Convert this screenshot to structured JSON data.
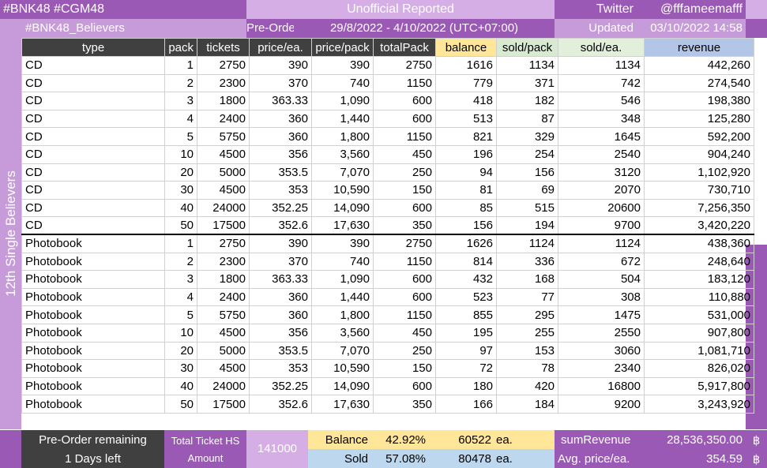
{
  "header": {
    "tags": "#BNK48 #CGM48",
    "title": "Unofficial  Reported",
    "platform": "Twitter",
    "handle": "@fffameemafff",
    "hashtag": "#BNK48_Believers",
    "preorder_label": "Pre-Order",
    "preorder_range": "29/8/2022 - 4/10/2022 (UTC+07:00)",
    "updated_label": "Updated",
    "updated_value": "03/10/2022 14:58"
  },
  "side_label": "12th Single Believers",
  "columns": [
    "type",
    "pack",
    "tickets",
    "price/ea.",
    "price/pack",
    "totalPack",
    "balance",
    "sold/pack",
    "sold/ea.",
    "revenue"
  ],
  "rows": [
    [
      "CD",
      "1",
      "2750",
      "390",
      "390",
      "2750",
      "1616",
      "1134",
      "1134",
      "442,260"
    ],
    [
      "CD",
      "2",
      "2300",
      "370",
      "740",
      "1150",
      "779",
      "371",
      "742",
      "274,540"
    ],
    [
      "CD",
      "3",
      "1800",
      "363.33",
      "1,090",
      "600",
      "418",
      "182",
      "546",
      "198,380"
    ],
    [
      "CD",
      "4",
      "2400",
      "360",
      "1,440",
      "600",
      "513",
      "87",
      "348",
      "125,280"
    ],
    [
      "CD",
      "5",
      "5750",
      "360",
      "1,800",
      "1150",
      "821",
      "329",
      "1645",
      "592,200"
    ],
    [
      "CD",
      "10",
      "4500",
      "356",
      "3,560",
      "450",
      "196",
      "254",
      "2540",
      "904,240"
    ],
    [
      "CD",
      "20",
      "5000",
      "353.5",
      "7,070",
      "250",
      "94",
      "156",
      "3120",
      "1,102,920"
    ],
    [
      "CD",
      "30",
      "4500",
      "353",
      "10,590",
      "150",
      "81",
      "69",
      "2070",
      "730,710"
    ],
    [
      "CD",
      "40",
      "24000",
      "352.25",
      "14,090",
      "600",
      "85",
      "515",
      "20600",
      "7,256,350"
    ],
    [
      "CD",
      "50",
      "17500",
      "352.6",
      "17,630",
      "350",
      "156",
      "194",
      "9700",
      "3,420,220"
    ],
    [
      "Photobook",
      "1",
      "2750",
      "390",
      "390",
      "2750",
      "1626",
      "1124",
      "1124",
      "438,360"
    ],
    [
      "Photobook",
      "2",
      "2300",
      "370",
      "740",
      "1150",
      "814",
      "336",
      "672",
      "248,640"
    ],
    [
      "Photobook",
      "3",
      "1800",
      "363.33",
      "1,090",
      "600",
      "432",
      "168",
      "504",
      "183,120"
    ],
    [
      "Photobook",
      "4",
      "2400",
      "360",
      "1,440",
      "600",
      "523",
      "77",
      "308",
      "110,880"
    ],
    [
      "Photobook",
      "5",
      "5750",
      "360",
      "1,800",
      "1150",
      "855",
      "295",
      "1475",
      "531,000"
    ],
    [
      "Photobook",
      "10",
      "4500",
      "356",
      "3,560",
      "450",
      "195",
      "255",
      "2550",
      "907,800"
    ],
    [
      "Photobook",
      "20",
      "5000",
      "353.5",
      "7,070",
      "250",
      "97",
      "153",
      "3060",
      "1,081,710"
    ],
    [
      "Photobook",
      "30",
      "4500",
      "353",
      "10,590",
      "150",
      "72",
      "78",
      "2340",
      "826,020"
    ],
    [
      "Photobook",
      "40",
      "24000",
      "352.25",
      "14,090",
      "600",
      "180",
      "420",
      "16800",
      "5,917,800"
    ],
    [
      "Photobook",
      "50",
      "17500",
      "352.6",
      "17,630",
      "350",
      "166",
      "184",
      "9200",
      "3,243,920"
    ]
  ],
  "footer": {
    "remaining_label": "Pre-Order remaining",
    "days_left": "1 Days left",
    "total_ticket_label1": "Total Ticket HS",
    "total_ticket_label2": "Amount",
    "total_ticket_value": "141000",
    "balance_label": "Balance",
    "balance_pct": "42.92%",
    "balance_count": "60522",
    "balance_unit": "ea.",
    "sold_label": "Sold",
    "sold_pct": "57.08%",
    "sold_count": "80478",
    "sold_unit": "ea.",
    "sum_revenue_label": "sumRevenue",
    "sum_revenue_value": "28,536,350.00",
    "avg_label": "Avg. price/ea.",
    "avg_value": "354.59",
    "currency": "฿"
  },
  "colors": {
    "purple": "#9b59b6",
    "lilac": "#d4aee4",
    "dark_header": "#404040",
    "balance_header": "#ffe699",
    "soldpack_header": "#d9ead3",
    "revenue_header": "#b4c6e7"
  }
}
